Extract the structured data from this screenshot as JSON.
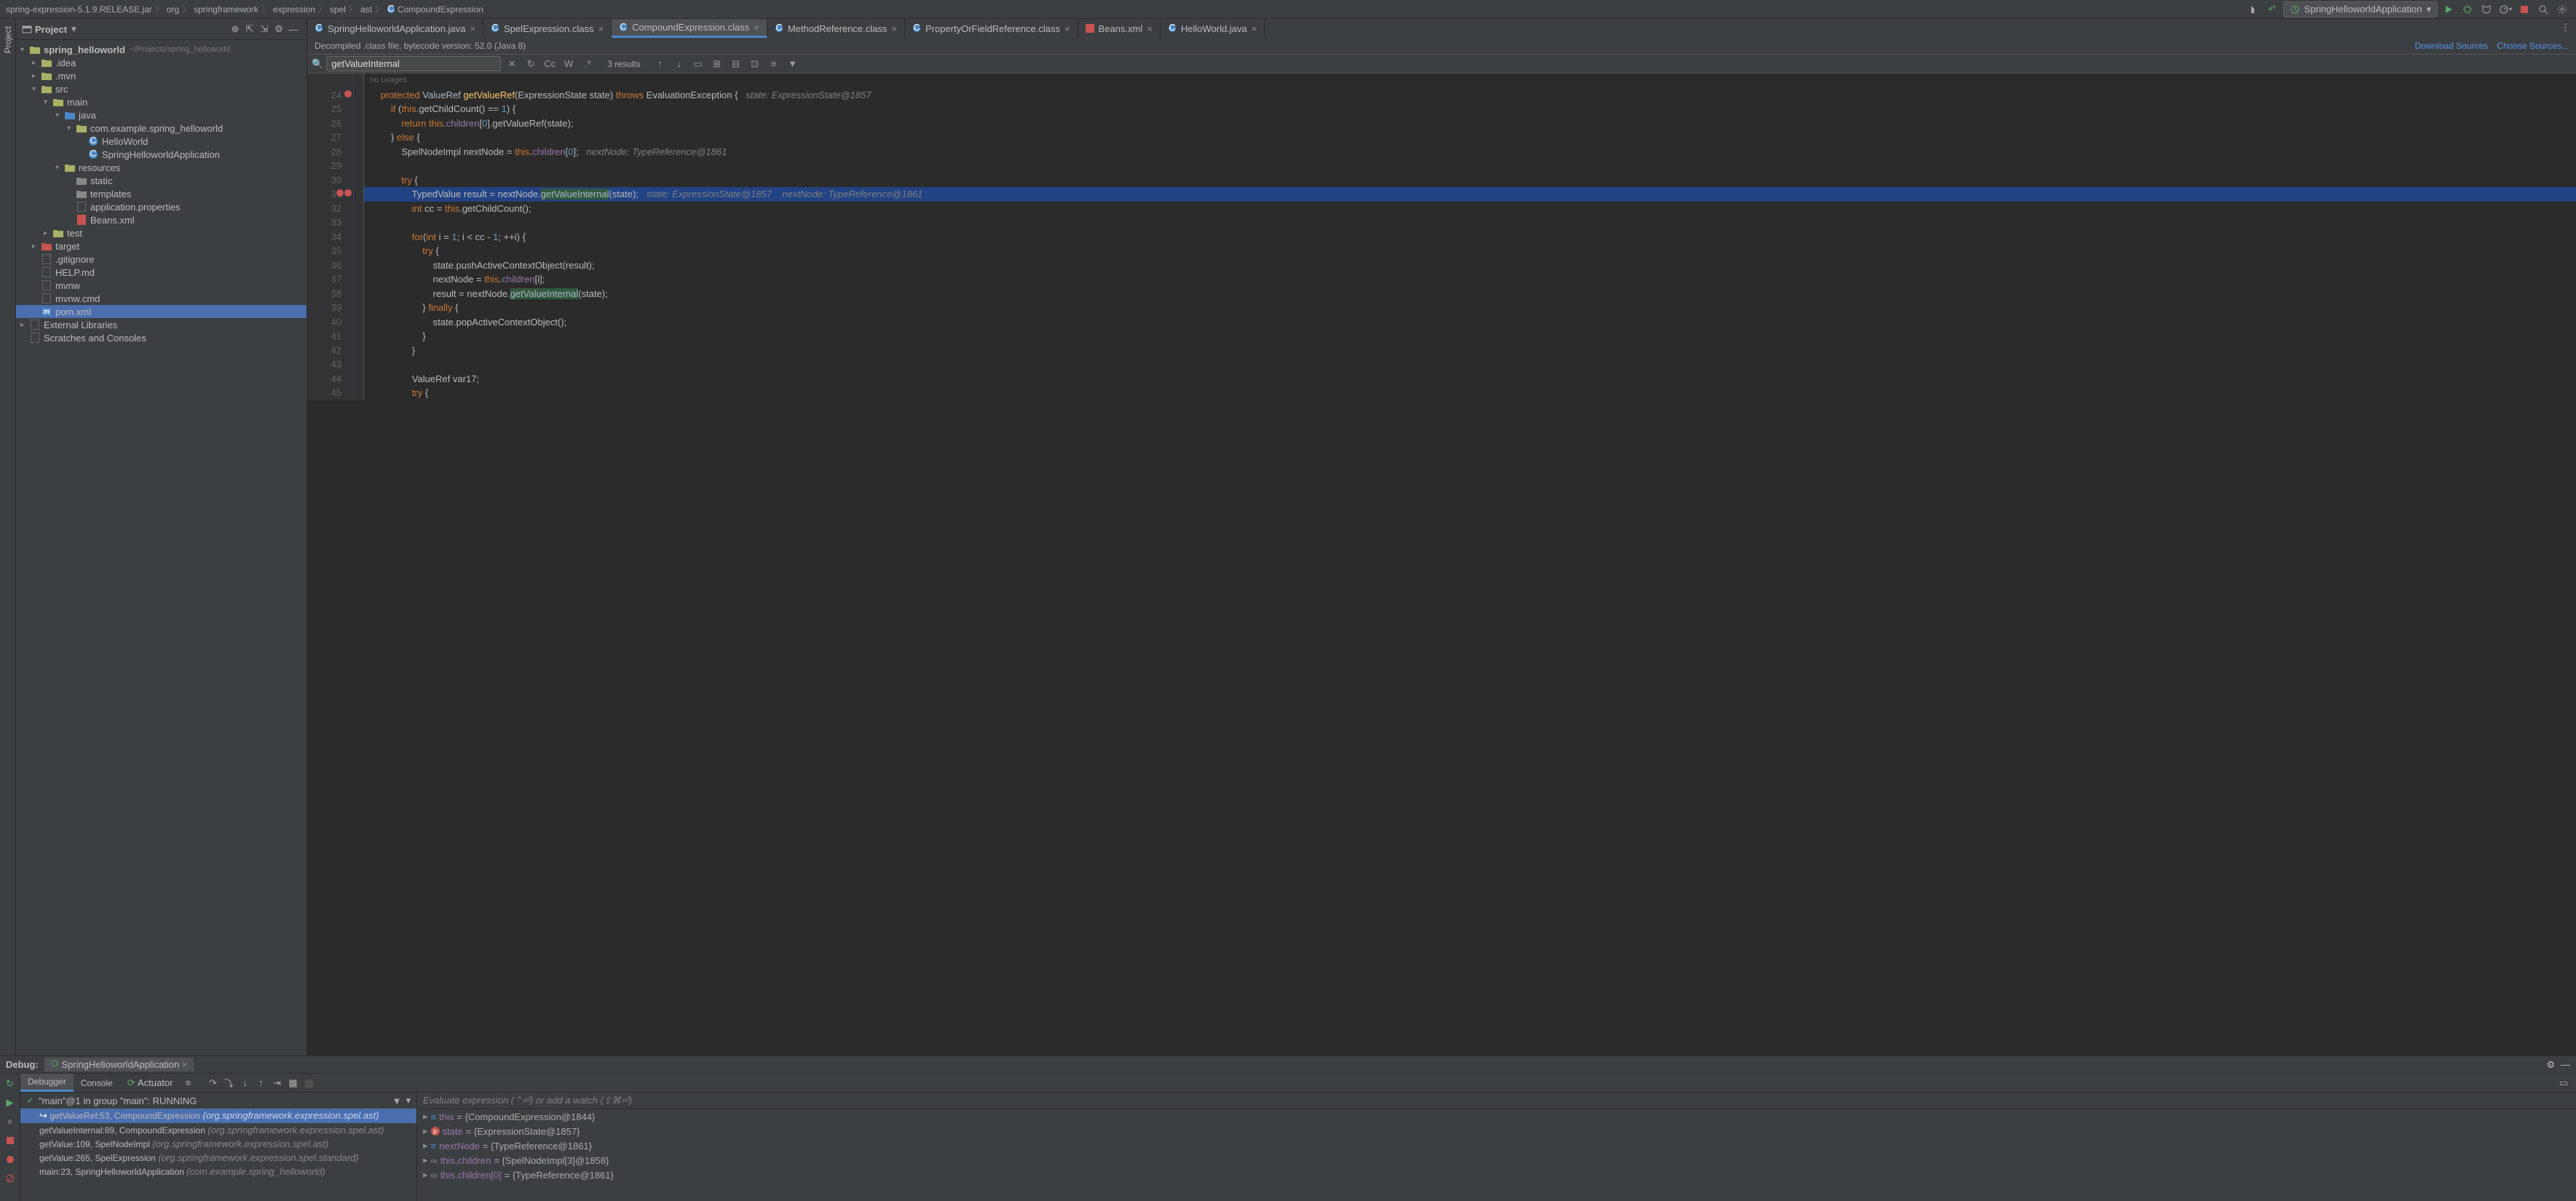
{
  "breadcrumb": [
    "spring-expression-5.1.9.RELEASE.jar",
    "org",
    "springframework",
    "expression",
    "spel",
    "ast",
    "CompoundExpression"
  ],
  "run_config": "SpringHelloworldApplication",
  "project_panel": {
    "title": "Project"
  },
  "tree": [
    {
      "d": 0,
      "exp": "▾",
      "name": "spring_helloworld",
      "loc": "~/Projects/spring_helloworld",
      "icon": "root"
    },
    {
      "d": 1,
      "exp": "▸",
      "name": ".idea",
      "icon": "folder"
    },
    {
      "d": 1,
      "exp": "▸",
      "name": ".mvn",
      "icon": "folder"
    },
    {
      "d": 1,
      "exp": "▾",
      "name": "src",
      "icon": "folder"
    },
    {
      "d": 2,
      "exp": "▾",
      "name": "main",
      "icon": "folder"
    },
    {
      "d": 3,
      "exp": "▾",
      "name": "java",
      "icon": "src-folder"
    },
    {
      "d": 4,
      "exp": "▾",
      "name": "com.example.spring_helloworld",
      "icon": "pkg"
    },
    {
      "d": 5,
      "exp": " ",
      "name": "HelloWorld",
      "icon": "class"
    },
    {
      "d": 5,
      "exp": " ",
      "name": "SpringHelloworldApplication",
      "icon": "class"
    },
    {
      "d": 3,
      "exp": "▾",
      "name": "resources",
      "icon": "res-folder"
    },
    {
      "d": 4,
      "exp": " ",
      "name": "static",
      "icon": "folder-gray"
    },
    {
      "d": 4,
      "exp": " ",
      "name": "templates",
      "icon": "folder-gray"
    },
    {
      "d": 4,
      "exp": " ",
      "name": "application.properties",
      "icon": "props"
    },
    {
      "d": 4,
      "exp": " ",
      "name": "Beans.xml",
      "icon": "xml"
    },
    {
      "d": 2,
      "exp": "▸",
      "name": "test",
      "icon": "folder"
    },
    {
      "d": 1,
      "exp": "▸",
      "name": "target",
      "icon": "target",
      "sel": false
    },
    {
      "d": 1,
      "exp": " ",
      "name": ".gitignore",
      "icon": "file"
    },
    {
      "d": 1,
      "exp": " ",
      "name": "HELP.md",
      "icon": "md"
    },
    {
      "d": 1,
      "exp": " ",
      "name": "mvnw",
      "icon": "file"
    },
    {
      "d": 1,
      "exp": " ",
      "name": "mvnw.cmd",
      "icon": "file"
    },
    {
      "d": 1,
      "exp": " ",
      "name": "pom.xml",
      "icon": "maven",
      "sel": true
    },
    {
      "d": 0,
      "exp": "▸",
      "name": "External Libraries",
      "icon": "lib"
    },
    {
      "d": 0,
      "exp": " ",
      "name": "Scratches and Consoles",
      "icon": "scratch"
    }
  ],
  "tabs": [
    {
      "label": "SpringHelloworldApplication.java",
      "icon": "class"
    },
    {
      "label": "SpelExpression.class",
      "icon": "class"
    },
    {
      "label": "CompoundExpression.class",
      "icon": "class",
      "active": true
    },
    {
      "label": "MethodReference.class",
      "icon": "class"
    },
    {
      "label": "PropertyOrFieldReference.class",
      "icon": "class"
    },
    {
      "label": "Beans.xml",
      "icon": "xml"
    },
    {
      "label": "HelloWorld.java",
      "icon": "class"
    }
  ],
  "banner": {
    "text": "Decompiled .class file, bytecode version: 52.0 (Java 8)",
    "link1": "Download Sources",
    "link2": "Choose Sources..."
  },
  "find": {
    "value": "getValueInternal",
    "results": "3 results"
  },
  "usages_label": "no usages",
  "code": [
    {
      "n": 24,
      "bp": 1,
      "html": "    <span class='kw'>protected</span> <span class='typ'>ValueRef</span> <span class='met'>getValueRef</span>(ExpressionState state) <span class='kw'>throws</span> EvaluationException {   <span class='com'>state: ExpressionState@1857</span>"
    },
    {
      "n": 25,
      "html": "        <span class='kw'>if</span> (<span class='kw'>this</span>.getChildCount() == <span class='num'>1</span>) {"
    },
    {
      "n": 26,
      "html": "            <span class='kw'>return</span> <span class='kw'>this</span>.<span class='fld'>children</span>[<span class='num'>0</span>].getValueRef(state);"
    },
    {
      "n": 27,
      "html": "        } <span class='kw'>else</span> {"
    },
    {
      "n": 28,
      "html": "            SpelNodeImpl nextNode = <span class='kw'>this</span>.<span class='fld'>children</span>[<span class='num'>0</span>];   <span class='com'>nextNode: TypeReference@1861</span>"
    },
    {
      "n": 29,
      "html": ""
    },
    {
      "n": 30,
      "html": "            <span class='kw'>try</span> {"
    },
    {
      "n": 31,
      "bp": 2,
      "hl": true,
      "html": "                TypedValue result = nextNode.<span class='hl-search'>getValueInternal</span>(state);   <span class='com'>state: ExpressionState@1857    nextNode: TypeReference@1861</span>"
    },
    {
      "n": 32,
      "html": "                <span class='kw'>int</span> cc = <span class='kw'>this</span>.getChildCount();"
    },
    {
      "n": 33,
      "html": ""
    },
    {
      "n": 34,
      "html": "                <span class='kw'>for</span>(<span class='kw'>int</span> i = <span class='num'>1</span>; i < cc - <span class='num'>1</span>; ++i) {"
    },
    {
      "n": 35,
      "html": "                    <span class='kw'>try</span> {"
    },
    {
      "n": 36,
      "html": "                        state.pushActiveContextObject(result);"
    },
    {
      "n": 37,
      "html": "                        nextNode = <span class='kw'>this</span>.<span class='fld'>children</span>[i];"
    },
    {
      "n": 38,
      "html": "                        result = nextNode.<span class='hl-search'>getValueInternal</span>(state);"
    },
    {
      "n": 39,
      "html": "                    } <span class='kw'>finally</span> {"
    },
    {
      "n": 40,
      "html": "                        state.popActiveContextObject();"
    },
    {
      "n": 41,
      "html": "                    }"
    },
    {
      "n": 42,
      "html": "                }"
    },
    {
      "n": 43,
      "html": ""
    },
    {
      "n": 44,
      "html": "                ValueRef var17;"
    },
    {
      "n": 45,
      "html": "                <span class='kw'>try</span> {"
    }
  ],
  "debug": {
    "title": "Debug:",
    "config": "SpringHelloworldApplication",
    "tabs": [
      "Debugger",
      "Console",
      "Actuator"
    ],
    "thread": "\"main\"@1 in group \"main\": RUNNING",
    "frames": [
      {
        "sel": true,
        "text": "getValueRef:53, CompoundExpression",
        "pkg": "(org.springframework.expression.spel.ast)"
      },
      {
        "text": "getValueInternal:89, CompoundExpression",
        "pkg": "(org.springframework.expression.spel.ast)"
      },
      {
        "text": "getValue:109, SpelNodeImpl",
        "pkg": "(org.springframework.expression.spel.ast)"
      },
      {
        "text": "getValue:265, SpelExpression",
        "pkg": "(org.springframework.expression.spel.standard)"
      },
      {
        "text": "main:23, SpringHelloworldApplication",
        "pkg": "(com.example.spring_helloworld)"
      }
    ],
    "eval_placeholder": "Evaluate expression (⌃⏎) or add a watch (⇧⌘⏎)",
    "vars": [
      {
        "k": "this",
        "v": "= {CompoundExpression@1844}"
      },
      {
        "k": "state",
        "v": "= {ExpressionState@1857}",
        "param": true
      },
      {
        "k": "nextNode",
        "v": "= {TypeReference@1861}"
      },
      {
        "k": "this.children",
        "v": "= {SpelNodeImpl[3]@1858}",
        "link": true
      },
      {
        "k": "this.children[0]",
        "v": "= {TypeReference@1861}",
        "link": true
      }
    ]
  }
}
